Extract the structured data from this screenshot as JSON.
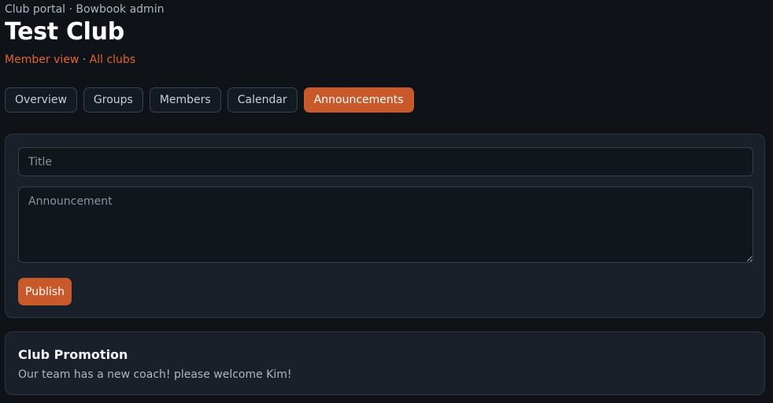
{
  "header": {
    "subtitle": "Club portal · Bowbook admin",
    "title": "Test Club",
    "links": {
      "member_view": "Member view",
      "separator": " · ",
      "all_clubs": "All clubs"
    }
  },
  "tabs": [
    {
      "label": "Overview",
      "active": false
    },
    {
      "label": "Groups",
      "active": false
    },
    {
      "label": "Members",
      "active": false
    },
    {
      "label": "Calendar",
      "active": false
    },
    {
      "label": "Announcements",
      "active": true
    }
  ],
  "form": {
    "title_placeholder": "Title",
    "title_value": "",
    "announcement_placeholder": "Announcement",
    "announcement_value": "",
    "publish_label": "Publish"
  },
  "announcements": [
    {
      "title": "Club Promotion",
      "body": "Our team has a new coach! please welcome Kim!"
    }
  ],
  "colors": {
    "accent": "#c9592a",
    "link": "#e0652f",
    "background": "#0f1318",
    "card": "#1a202a"
  }
}
